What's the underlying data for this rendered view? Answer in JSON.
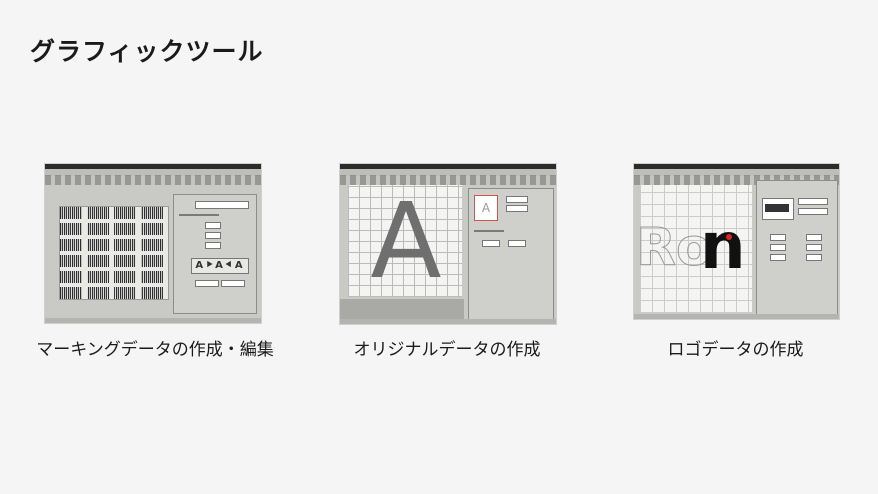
{
  "page": {
    "title": "グラフィックツール"
  },
  "cards": [
    {
      "caption": "マーキングデータの作成・編集"
    },
    {
      "caption": "オリジナルデータの作成",
      "glyph": "A"
    },
    {
      "caption": "ロゴデータの作成",
      "glyph": "n"
    }
  ]
}
